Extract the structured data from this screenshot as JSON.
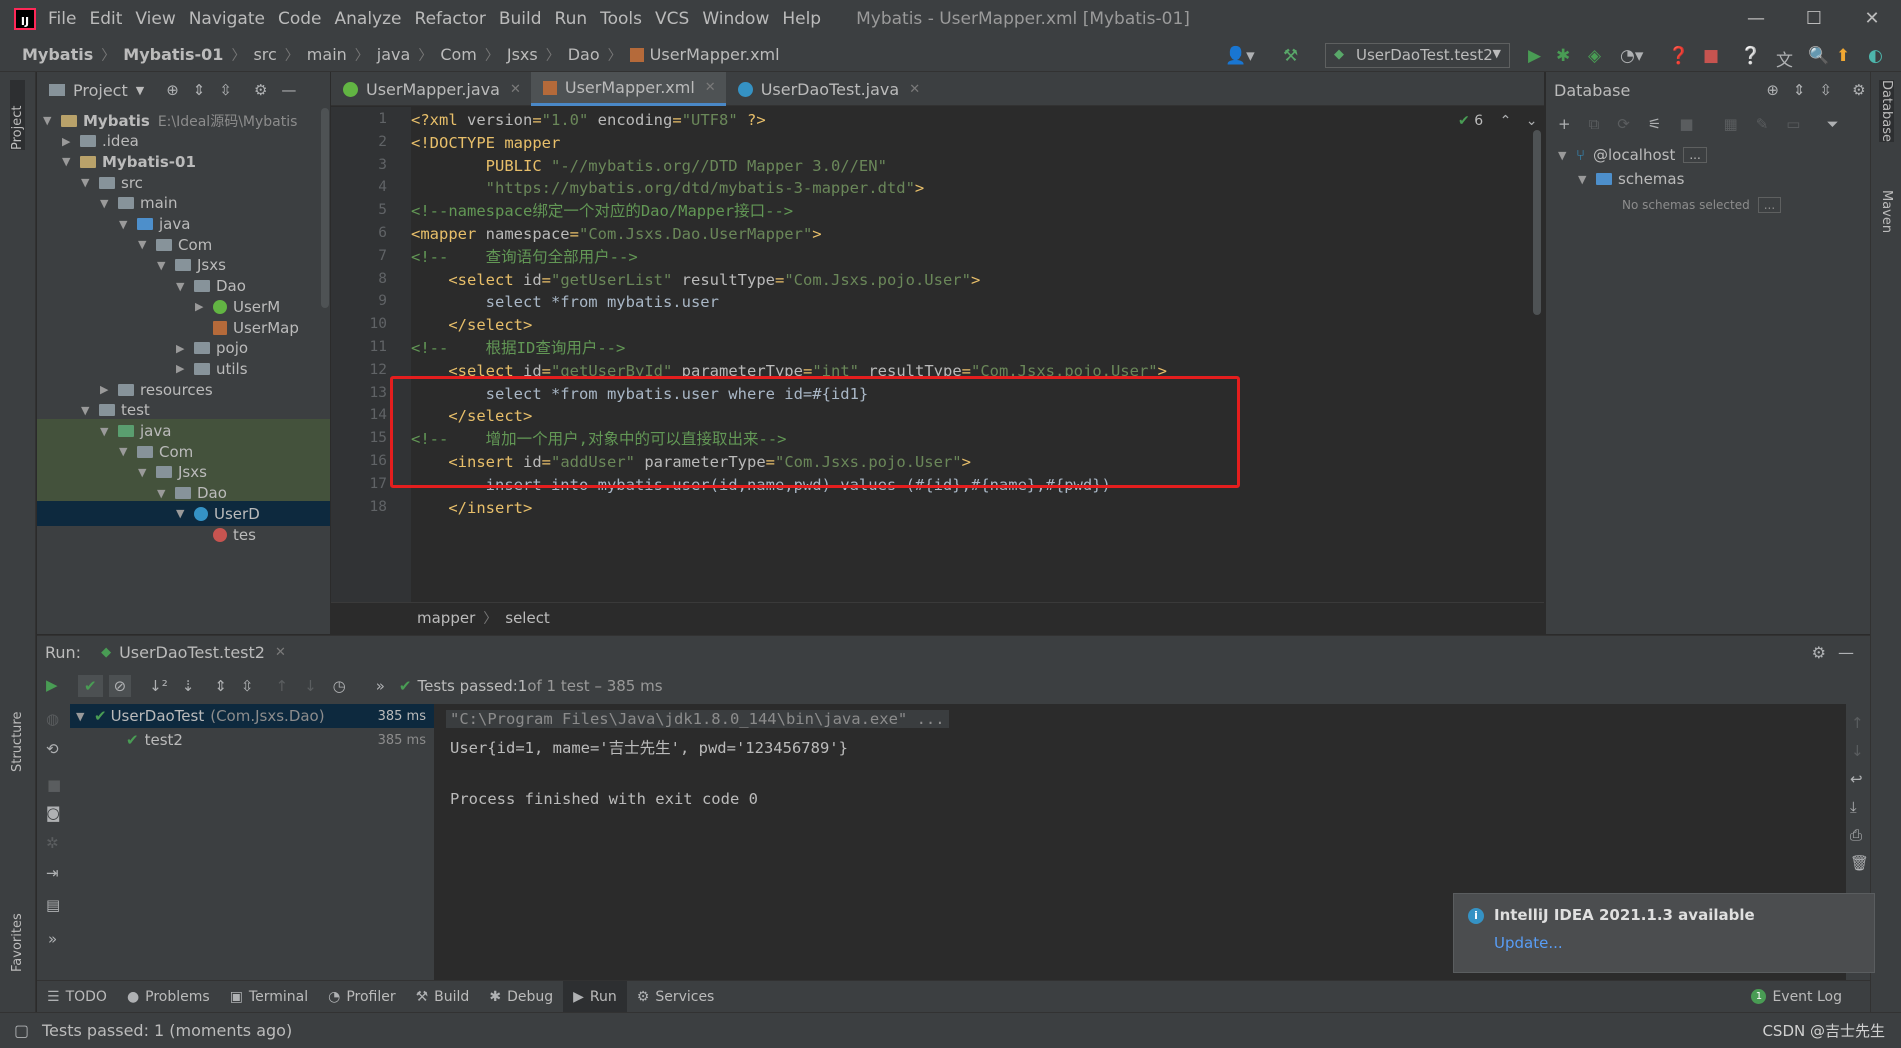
{
  "title_bar": {
    "menu": [
      "File",
      "Edit",
      "View",
      "Navigate",
      "Code",
      "Analyze",
      "Refactor",
      "Build",
      "Run",
      "Tools",
      "VCS",
      "Window",
      "Help"
    ],
    "window_title": "Mybatis - UserMapper.xml [Mybatis-01]"
  },
  "nav": {
    "crumbs": [
      "Mybatis",
      "Mybatis-01",
      "src",
      "main",
      "java",
      "Com",
      "Jsxs",
      "Dao",
      "UserMapper.xml"
    ],
    "run_config": "UserDaoTest.test2"
  },
  "left_stripe": {
    "project": "Project",
    "structure": "Structure",
    "favorites": "Favorites"
  },
  "right_stripe": {
    "database": "Database",
    "maven": "Maven"
  },
  "project_panel": {
    "title": "Project",
    "tree": [
      {
        "label": "Mybatis",
        "extra": "E:\\Ideal源码\\Mybatis",
        "depth": 0,
        "icon": "folder-gold",
        "expanded": true
      },
      {
        "label": ".idea",
        "depth": 1,
        "icon": "folder-gray",
        "expanded": false
      },
      {
        "label": "Mybatis-01",
        "depth": 1,
        "icon": "folder-gold",
        "expanded": true
      },
      {
        "label": "src",
        "depth": 2,
        "icon": "folder-gray",
        "expanded": true
      },
      {
        "label": "main",
        "depth": 3,
        "icon": "folder-gray",
        "expanded": true
      },
      {
        "label": "java",
        "depth": 4,
        "icon": "folder-blue",
        "expanded": true
      },
      {
        "label": "Com",
        "depth": 5,
        "icon": "package-icon",
        "expanded": true
      },
      {
        "label": "Jsxs",
        "depth": 6,
        "icon": "package-icon",
        "expanded": true
      },
      {
        "label": "Dao",
        "depth": 7,
        "icon": "package-icon",
        "expanded": true
      },
      {
        "label": "UserM",
        "depth": 8,
        "icon": "interface-icon",
        "expanded": false
      },
      {
        "label": "UserMap",
        "depth": 8,
        "icon": "xml-file-icon",
        "expanded": null
      },
      {
        "label": "pojo",
        "depth": 7,
        "icon": "package-icon",
        "expanded": false
      },
      {
        "label": "utils",
        "depth": 7,
        "icon": "package-icon",
        "expanded": false
      },
      {
        "label": "resources",
        "depth": 3,
        "icon": "folder-gray",
        "expanded": false
      },
      {
        "label": "test",
        "depth": 2,
        "icon": "folder-gray",
        "expanded": true
      },
      {
        "label": "java",
        "depth": 3,
        "icon": "folder-green",
        "expanded": true
      },
      {
        "label": "Com",
        "depth": 4,
        "icon": "package-icon",
        "expanded": true
      },
      {
        "label": "Jsxs",
        "depth": 5,
        "icon": "package-icon",
        "expanded": true
      },
      {
        "label": "Dao",
        "depth": 6,
        "icon": "package-icon",
        "expanded": true
      },
      {
        "label": "UserD",
        "depth": 7,
        "icon": "class-icon",
        "expanded": true
      },
      {
        "label": "tes",
        "depth": 8,
        "icon": "method-icon",
        "expanded": null
      }
    ]
  },
  "tabs": [
    {
      "label": "UserMapper.java",
      "active": false
    },
    {
      "label": "UserMapper.xml",
      "active": true
    },
    {
      "label": "UserDaoTest.java",
      "active": false
    }
  ],
  "editor": {
    "line_numbers": [
      "1",
      "2",
      "3",
      "4",
      "5",
      "6",
      "7",
      "8",
      "9",
      "10",
      "11",
      "12",
      "13",
      "14",
      "15",
      "16",
      "17",
      "18"
    ],
    "inspection_count": "6",
    "lines": [
      [
        [
          "t",
          "<?xml "
        ],
        [
          "a",
          "version"
        ],
        [
          "t",
          "="
        ],
        [
          "v",
          "\"1.0\""
        ],
        [
          "a",
          " encoding"
        ],
        [
          "t",
          "="
        ],
        [
          "v",
          "\"UTF8\""
        ],
        [
          "t",
          " ?>"
        ]
      ],
      [
        [
          "t",
          "<!DOCTYPE mapper"
        ]
      ],
      [
        [
          "t",
          "        PUBLIC "
        ],
        [
          "v",
          "\"-//mybatis.org//DTD Mapper 3.0//EN\""
        ]
      ],
      [
        [
          "v",
          "        \"https://mybatis.org/dtd/mybatis-3-mapper.dtd\""
        ],
        [
          "t",
          ">"
        ]
      ],
      [
        [
          "c",
          "<!--namespace绑定一个对应的Dao/Mapper接口-->"
        ]
      ],
      [
        [
          "t",
          "<mapper "
        ],
        [
          "a",
          "namespace"
        ],
        [
          "t",
          "="
        ],
        [
          "v",
          "\"Com.Jsxs.Dao.UserMapper\""
        ],
        [
          "t",
          ">"
        ]
      ],
      [
        [
          "c",
          "<!--    查询语句全部用户-->"
        ]
      ],
      [
        [
          "t",
          "    <select "
        ],
        [
          "a",
          "id"
        ],
        [
          "t",
          "="
        ],
        [
          "v",
          "\"getUserList\""
        ],
        [
          "a",
          " resultType"
        ],
        [
          "t",
          "="
        ],
        [
          "v",
          "\"Com.Jsxs.pojo.User\""
        ],
        [
          "t",
          ">"
        ]
      ],
      [
        [
          "p",
          "        select *from mybatis.user"
        ]
      ],
      [
        [
          "t",
          "    </select>"
        ]
      ],
      [
        [
          "c",
          "<!--    根据ID查询用户-->"
        ]
      ],
      [
        [
          "t",
          "    <select "
        ],
        [
          "a",
          "id"
        ],
        [
          "t",
          "="
        ],
        [
          "v",
          "\"getUserById\""
        ],
        [
          "a",
          " parameterType"
        ],
        [
          "t",
          "="
        ],
        [
          "v",
          "\"int\""
        ],
        [
          "a",
          " resultType"
        ],
        [
          "t",
          "="
        ],
        [
          "v",
          "\"Com.Jsxs.pojo.User\""
        ],
        [
          "t",
          ">"
        ]
      ],
      [
        [
          "p",
          "        select *from mybatis.user where id=#{id1}"
        ]
      ],
      [
        [
          "t",
          "    </select>"
        ]
      ],
      [
        [
          "c",
          "<!--    增加一个用户,对象中的可以直接取出来-->"
        ]
      ],
      [
        [
          "t",
          "    <insert "
        ],
        [
          "a",
          "id"
        ],
        [
          "t",
          "="
        ],
        [
          "v",
          "\"addUser\""
        ],
        [
          "a",
          " parameterType"
        ],
        [
          "t",
          "="
        ],
        [
          "v",
          "\"Com.Jsxs.pojo.User\""
        ],
        [
          "t",
          ">"
        ]
      ],
      [
        [
          "p",
          "        insert into mybatis.user(id,name,pwd) values (#{id},#{name},#{pwd})"
        ]
      ],
      [
        [
          "t",
          "    </insert>"
        ]
      ]
    ],
    "breadcrumb": [
      "mapper",
      "select"
    ]
  },
  "database_panel": {
    "title": "Database",
    "host": "@localhost",
    "host_more": "...",
    "schemas": "schemas",
    "no_schemas": "No schemas selected",
    "no_schemas_more": "..."
  },
  "run_panel": {
    "label": "Run:",
    "tab": "UserDaoTest.test2",
    "status_prefix": "Tests passed: ",
    "status_count": "1",
    "status_suffix": " of 1 test – 385 ms",
    "tests": [
      {
        "name": "UserDaoTest",
        "detail": "(Com.Jsxs.Dao)",
        "time": "385 ms"
      },
      {
        "name": "test2",
        "detail": "",
        "time": "385 ms"
      }
    ],
    "console": [
      "\"C:\\Program Files\\Java\\jdk1.8.0_144\\bin\\java.exe\" ...",
      "User{id=1, mame='吉士先生', pwd='123456789'}",
      "",
      "Process finished with exit code 0"
    ]
  },
  "notification": {
    "title": "IntelliJ IDEA 2021.1.3 available",
    "link": "Update..."
  },
  "bottom_tools": [
    "TODO",
    "Problems",
    "Terminal",
    "Profiler",
    "Build",
    "Debug",
    "Run",
    "Services"
  ],
  "event_log": {
    "count": "1",
    "label": "Event Log"
  },
  "status": {
    "message": "Tests passed: 1 (moments ago)",
    "watermark": "CSDN @吉士先生"
  },
  "colors": {
    "accent": "#4a88c7",
    "success": "#499c54",
    "highlight_box": "#e41e1e"
  }
}
